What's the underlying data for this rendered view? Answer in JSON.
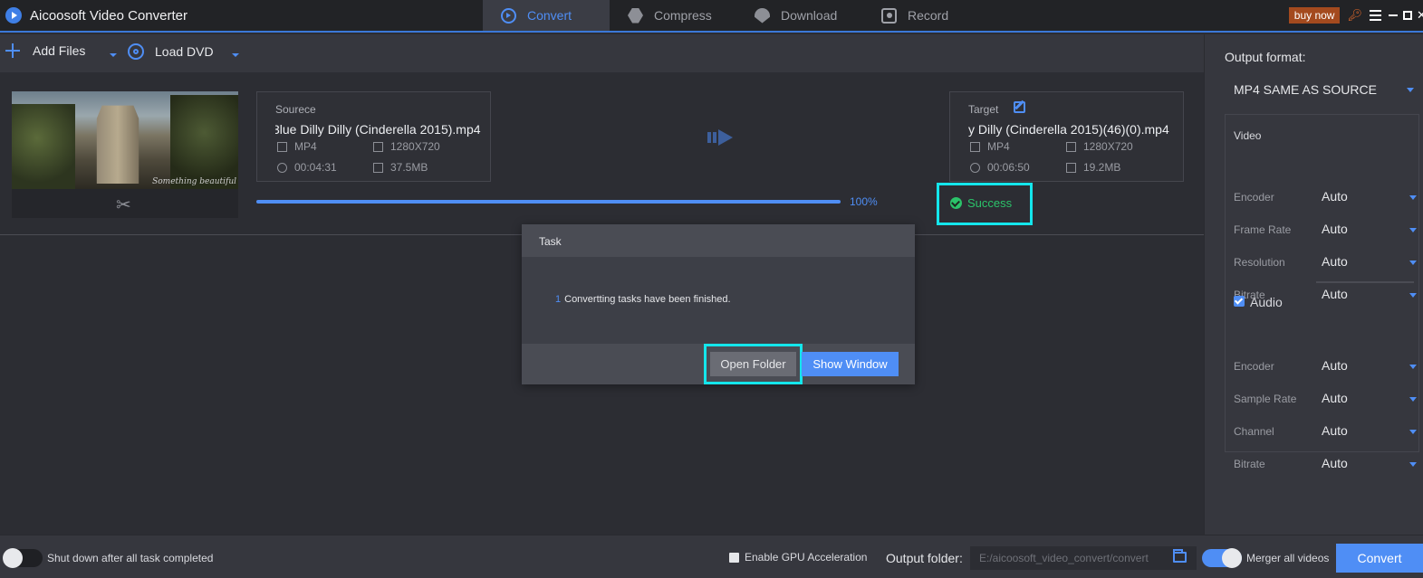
{
  "app": {
    "title": "Aicoosoft Video Converter"
  },
  "tabs": [
    {
      "label": "Convert",
      "icon": "convert-icon",
      "active": true
    },
    {
      "label": "Compress",
      "icon": "compress-icon",
      "active": false
    },
    {
      "label": "Download",
      "icon": "download-icon",
      "active": false
    },
    {
      "label": "Record",
      "icon": "record-icon",
      "active": false
    }
  ],
  "titlebar": {
    "buy_label": "buy now"
  },
  "toolbar": {
    "add_files": "Add Files",
    "load_dvd": "Load DVD"
  },
  "file": {
    "thumb_caption": "Something beautiful",
    "source": {
      "label": "Sourece",
      "name": "3lue Dilly Dilly (Cinderella 2015).mp4",
      "format": "MP4",
      "resolution": "1280X720",
      "duration": "00:04:31",
      "size": "37.5MB"
    },
    "target": {
      "label": "Target",
      "name": "y Dilly (Cinderella 2015)(46)(0).mp4",
      "format": "MP4",
      "resolution": "1280X720",
      "duration": "00:06:50",
      "size": "19.2MB"
    },
    "progress_percent": 100,
    "progress_text": "100%",
    "status": "Success"
  },
  "settings": {
    "output_format_label": "Output format:",
    "output_format": "MP4 SAME AS SOURCE",
    "video_title": "Video",
    "video_rows": [
      {
        "label": "Encoder",
        "value": "Auto"
      },
      {
        "label": "Frame Rate",
        "value": "Auto"
      },
      {
        "label": "Resolution",
        "value": "Auto"
      },
      {
        "label": "Bitrate",
        "value": "Auto"
      }
    ],
    "audio_title": "Audio",
    "audio_checked": true,
    "audio_rows": [
      {
        "label": "Encoder",
        "value": "Auto"
      },
      {
        "label": "Sample Rate",
        "value": "Auto"
      },
      {
        "label": "Channel",
        "value": "Auto"
      },
      {
        "label": "Bitrate",
        "value": "Auto"
      }
    ]
  },
  "bottom": {
    "shutdown_label": "Shut down after all task completed",
    "shutdown_on": false,
    "gpu_label": "Enable GPU Acceleration",
    "output_folder_label": "Output folder:",
    "output_folder_path": "E:/aicoosoft_video_convert/convert",
    "merge_label": "Merger all videos",
    "merge_on": true,
    "convert_label": "Convert"
  },
  "dialog": {
    "title": "Task",
    "count": "1",
    "message": "Convertting tasks have been finished.",
    "open_folder": "Open Folder",
    "show_window": "Show Window"
  },
  "colors": {
    "accent": "#4f8ef5",
    "success": "#2bc36a",
    "highlight": "#14e6ec",
    "buy": "#a44a1e"
  }
}
